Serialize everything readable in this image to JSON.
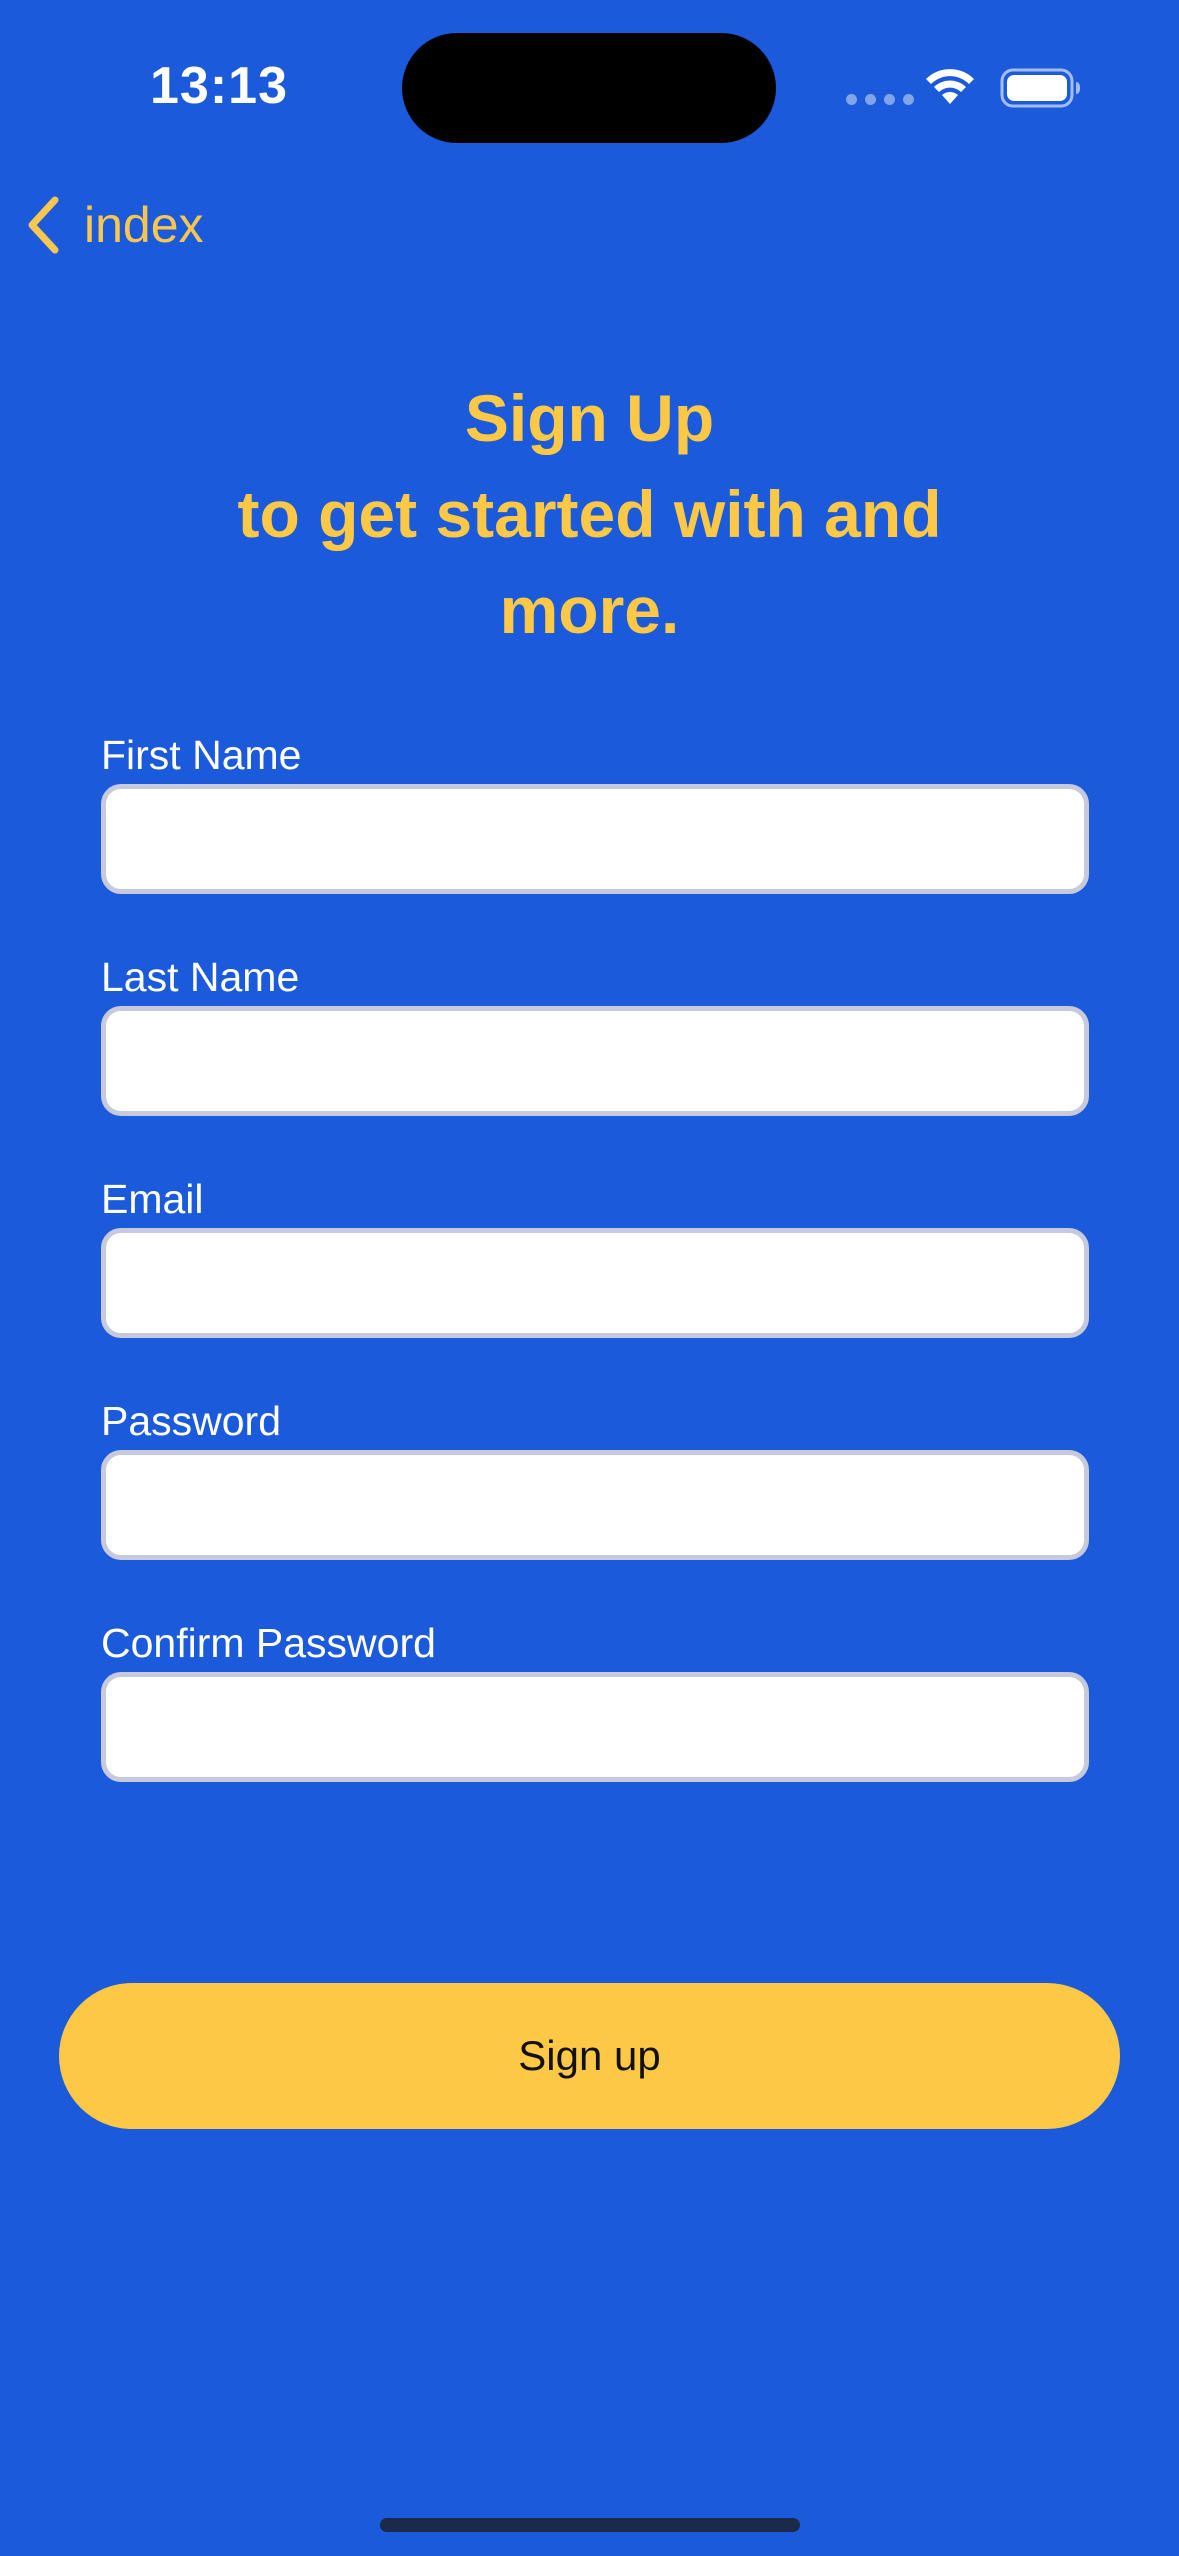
{
  "status_bar": {
    "time": "13:13",
    "icons": [
      "cellular-signal-icon",
      "wifi-icon",
      "battery-icon"
    ]
  },
  "nav": {
    "back_label": "index",
    "back_icon": "chevron-left-icon"
  },
  "heading": {
    "line1": "Sign Up",
    "line2": "to get started with and",
    "line3": "more."
  },
  "form": {
    "fields": [
      {
        "label": "First Name",
        "value": "",
        "placeholder": ""
      },
      {
        "label": "Last Name",
        "value": "",
        "placeholder": ""
      },
      {
        "label": "Email",
        "value": "",
        "placeholder": ""
      },
      {
        "label": "Password",
        "value": "",
        "placeholder": ""
      },
      {
        "label": "Confirm Password",
        "value": "",
        "placeholder": ""
      }
    ]
  },
  "actions": {
    "signup_label": "Sign up"
  },
  "colors": {
    "background": "#1a5adb",
    "accent": "#fcc846",
    "input_border": "#c7c9dc",
    "label_text": "#ffffff"
  }
}
